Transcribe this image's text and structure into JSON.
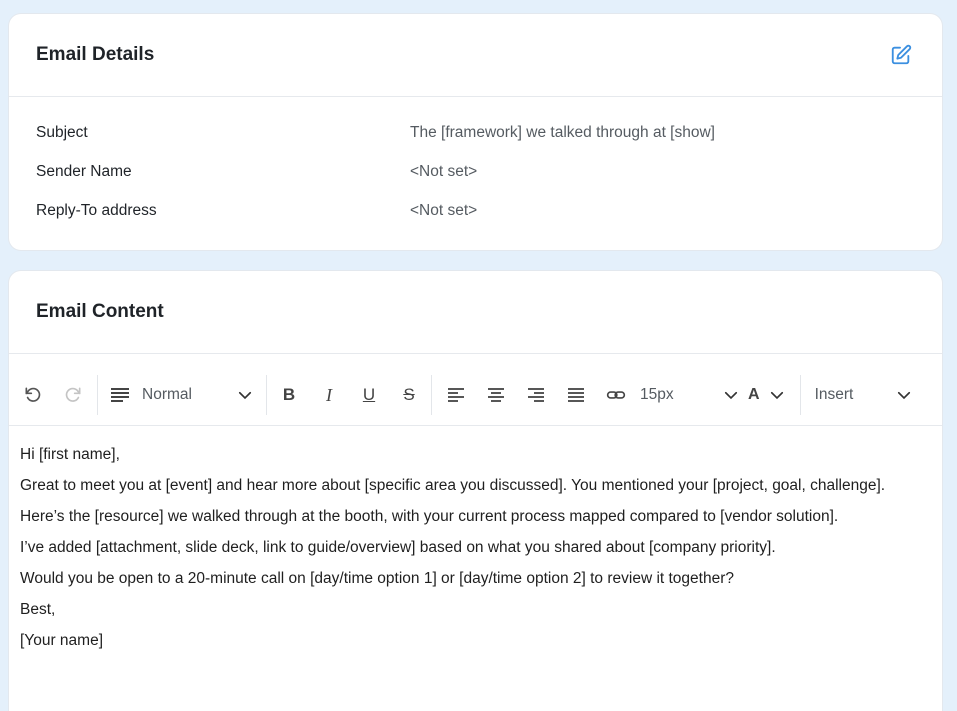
{
  "details": {
    "title": "Email Details",
    "rows": [
      {
        "label": "Subject",
        "value": "The [framework] we talked through at [show]"
      },
      {
        "label": "Sender Name",
        "value": "<Not set>"
      },
      {
        "label": "Reply-To address",
        "value": "<Not set>"
      }
    ],
    "edit_icon": "edit-pencil-icon"
  },
  "content": {
    "title": "Email Content",
    "toolbar": {
      "block_format": "Normal",
      "font_size": "15px",
      "insert_label": "Insert"
    },
    "body": [
      "Hi [first name],",
      "Great to meet you at [event] and hear more about [specific area you discussed]. You mentioned your [project, goal, challenge].",
      "Here’s the [resource] we walked through at the booth, with your current process mapped compared to [vendor solution].",
      "I’ve added [attachment, slide deck, link to guide/overview] based on what you shared about [company priority].",
      "Would you be open to a 20-minute call on [day/time option 1] or [day/time option 2] to review it together?",
      "Best,",
      "[Your name]"
    ]
  },
  "colors": {
    "accent": "#3b8fe0",
    "background": "#e4f0fb"
  }
}
